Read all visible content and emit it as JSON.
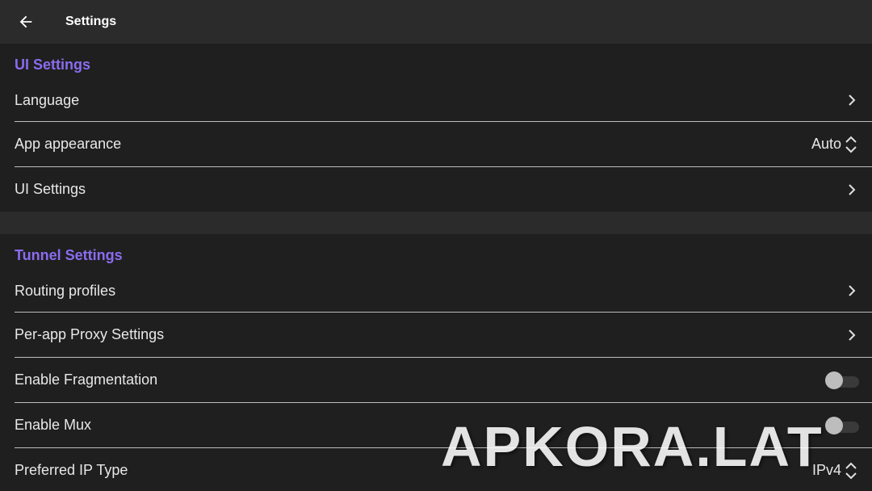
{
  "header": {
    "title": "Settings",
    "back_icon": "arrow-left-icon"
  },
  "sections": [
    {
      "title": "UI Settings",
      "rows": [
        {
          "label": "Language",
          "trailing": "chevron-right-icon"
        },
        {
          "label": "App appearance",
          "value": "Auto",
          "trailing": "unfold-icon"
        },
        {
          "label": "UI Settings",
          "trailing": "chevron-right-icon"
        }
      ]
    },
    {
      "title": "Tunnel Settings",
      "rows": [
        {
          "label": "Routing profiles",
          "trailing": "chevron-right-icon"
        },
        {
          "label": "Per-app Proxy Settings",
          "trailing": "chevron-right-icon"
        },
        {
          "label": "Enable Fragmentation",
          "toggle": false
        },
        {
          "label": "Enable Mux",
          "toggle": false
        },
        {
          "label": "Preferred IP Type",
          "value": "IPv4",
          "trailing": "unfold-icon"
        }
      ]
    }
  ],
  "watermark": "APKORA.LAT",
  "colors": {
    "accent": "#8b6cf0",
    "background": "#1f1f1f",
    "header_bg": "#2b2b2b"
  }
}
